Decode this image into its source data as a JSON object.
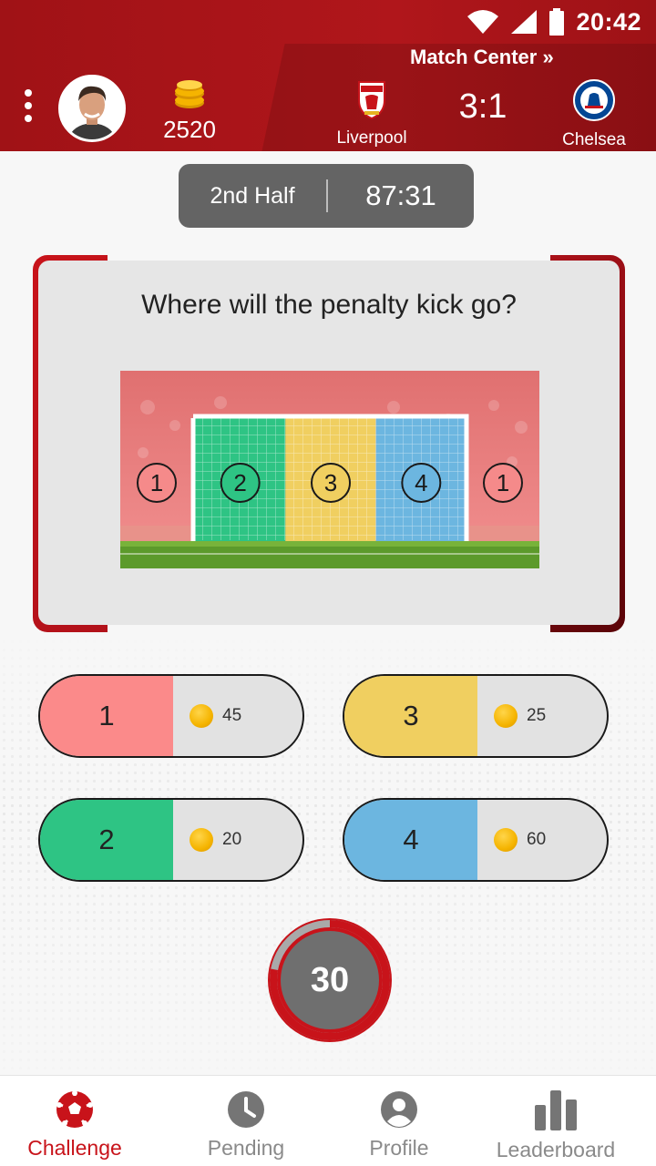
{
  "status_bar": {
    "time": "20:42",
    "icons": [
      "wifi-icon",
      "signal-icon",
      "battery-icon"
    ]
  },
  "header": {
    "match_center_link": "Match Center »",
    "coins": "2520",
    "home_team": {
      "name": "Liverpool",
      "crest": "liverpool-crest-icon"
    },
    "away_team": {
      "name": "Chelsea",
      "crest": "chelsea-crest-icon"
    },
    "score": "3:1"
  },
  "period": {
    "label": "2nd Half",
    "clock": "87:31"
  },
  "question": {
    "text": "Where will the penalty kick go?",
    "zones": [
      {
        "label": "1",
        "color": "#f58a8a"
      },
      {
        "label": "2",
        "color": "#2ec484"
      },
      {
        "label": "3",
        "color": "#f0cf60"
      },
      {
        "label": "4",
        "color": "#6cb6e0"
      },
      {
        "label": "1",
        "color": "#f58a8a"
      }
    ]
  },
  "options": [
    {
      "label": "1",
      "stake": "45",
      "color": "#fb8a8a"
    },
    {
      "label": "3",
      "stake": "25",
      "color": "#f0cf60"
    },
    {
      "label": "2",
      "stake": "20",
      "color": "#2ec484"
    },
    {
      "label": "4",
      "stake": "60",
      "color": "#6cb6e0"
    }
  ],
  "timer": {
    "value": "30",
    "remaining_fraction": 0.78
  },
  "nav": [
    {
      "label": "Challenge",
      "icon": "soccer-ball-icon",
      "active": true
    },
    {
      "label": "Pending",
      "icon": "clock-icon",
      "active": false
    },
    {
      "label": "Profile",
      "icon": "person-icon",
      "active": false
    },
    {
      "label": "Leaderboard",
      "icon": "bar-chart-icon",
      "active": false
    }
  ],
  "colors": {
    "brand_red": "#b0161b",
    "accent_red": "#c8131a",
    "nav_inactive": "#8a8a8a"
  }
}
